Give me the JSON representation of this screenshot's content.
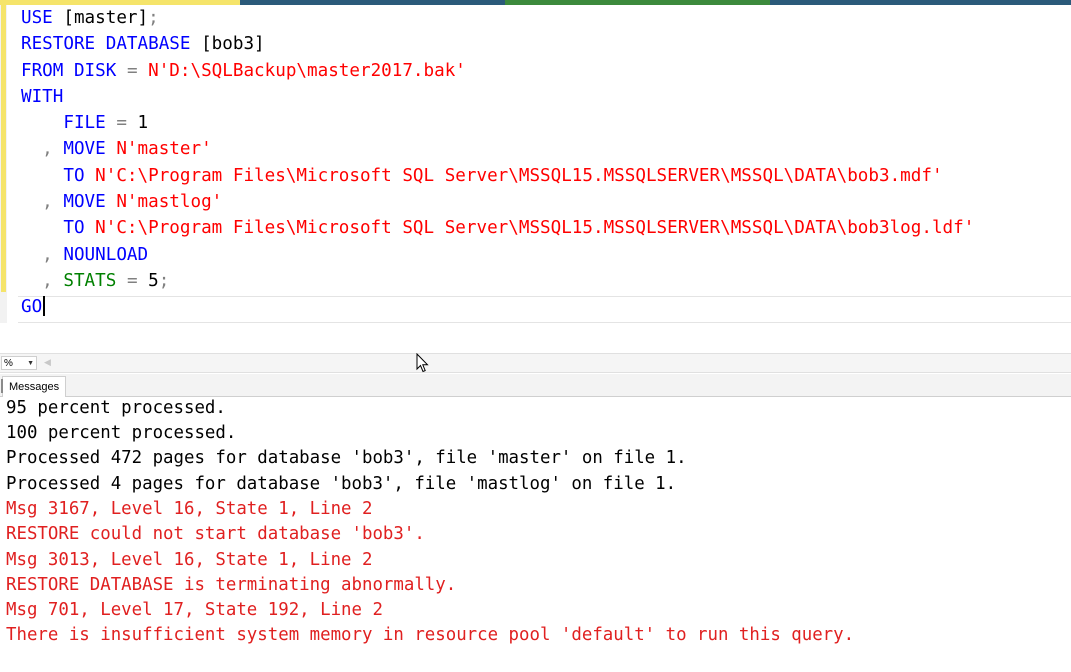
{
  "editor": {
    "lines": [
      [
        {
          "t": "USE ",
          "c": "kw"
        },
        {
          "t": "[master]",
          "c": "id"
        },
        {
          "t": ";",
          "c": "op"
        }
      ],
      [
        {
          "t": "RESTORE DATABASE ",
          "c": "kw"
        },
        {
          "t": "[bob3]",
          "c": "id"
        }
      ],
      [
        {
          "t": "FROM DISK ",
          "c": "kw"
        },
        {
          "t": "= ",
          "c": "op"
        },
        {
          "t": "N'D:\\SQLBackup\\master2017.bak'",
          "c": "str"
        }
      ],
      [
        {
          "t": "WITH",
          "c": "kw"
        }
      ],
      [
        {
          "t": "    FILE ",
          "c": "kw"
        },
        {
          "t": "= ",
          "c": "op"
        },
        {
          "t": "1",
          "c": "num"
        }
      ],
      [
        {
          "t": "  , ",
          "c": "op"
        },
        {
          "t": "MOVE ",
          "c": "kw"
        },
        {
          "t": "N'master'",
          "c": "str"
        }
      ],
      [
        {
          "t": "    TO ",
          "c": "kw"
        },
        {
          "t": "N'C:\\Program Files\\Microsoft SQL Server\\MSSQL15.MSSQLSERVER\\MSSQL\\DATA\\bob3.mdf'",
          "c": "str"
        }
      ],
      [
        {
          "t": "  , ",
          "c": "op"
        },
        {
          "t": "MOVE ",
          "c": "kw"
        },
        {
          "t": "N'mastlog'",
          "c": "str"
        }
      ],
      [
        {
          "t": "    TO ",
          "c": "kw"
        },
        {
          "t": "N'C:\\Program Files\\Microsoft SQL Server\\MSSQL15.MSSQLSERVER\\MSSQL\\DATA\\bob3log.ldf'",
          "c": "str"
        }
      ],
      [
        {
          "t": "  , ",
          "c": "op"
        },
        {
          "t": "NOUNLOAD",
          "c": "kw"
        }
      ],
      [
        {
          "t": "  , ",
          "c": "op"
        },
        {
          "t": "STATS ",
          "c": "fn"
        },
        {
          "t": "= ",
          "c": "op"
        },
        {
          "t": "5",
          "c": "num"
        },
        {
          "t": ";",
          "c": "op"
        }
      ],
      [
        {
          "t": "GO",
          "c": "kw"
        }
      ]
    ]
  },
  "zoombar": {
    "zoom_value": "%"
  },
  "results": {
    "tab_label": "Messages",
    "messages": [
      {
        "text": "95 percent processed.",
        "type": "info"
      },
      {
        "text": "100 percent processed.",
        "type": "info"
      },
      {
        "text": "Processed 472 pages for database 'bob3', file 'master' on file 1.",
        "type": "info"
      },
      {
        "text": "Processed 4 pages for database 'bob3', file 'mastlog' on file 1.",
        "type": "info"
      },
      {
        "text": "Msg 3167, Level 16, State 1, Line 2",
        "type": "err"
      },
      {
        "text": "RESTORE could not start database 'bob3'.",
        "type": "err"
      },
      {
        "text": "Msg 3013, Level 16, State 1, Line 2",
        "type": "err"
      },
      {
        "text": "RESTORE DATABASE is terminating abnormally.",
        "type": "err"
      },
      {
        "text": "Msg 701, Level 17, State 192, Line 2",
        "type": "err"
      },
      {
        "text": "There is insufficient system memory in resource pool 'default' to run this query.",
        "type": "err"
      }
    ]
  },
  "colors": {
    "keyword": "#0000ff",
    "string": "#ff0000",
    "function": "#008000",
    "error": "#e02020"
  }
}
